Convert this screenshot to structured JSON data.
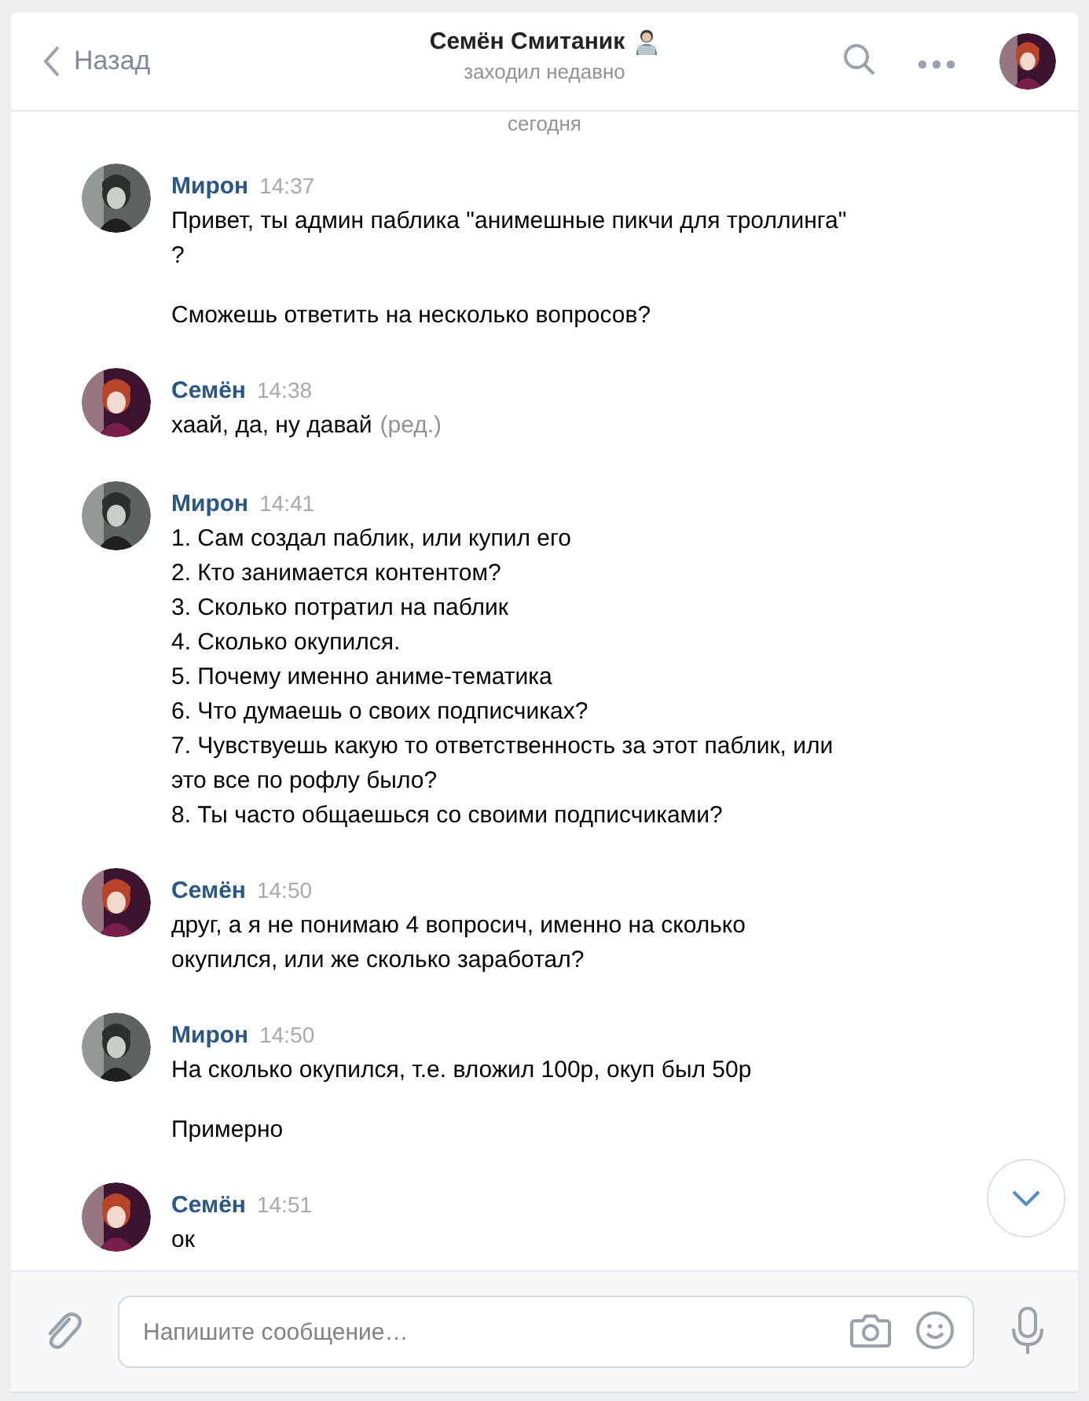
{
  "header": {
    "back_label": "Назад",
    "title": "Семён Смитаник",
    "status": "заходил недавно"
  },
  "date_divider": "сегодня",
  "messages": [
    {
      "author": "Мирон",
      "time": "14:37",
      "paragraphs": [
        [
          "Привет, ты админ паблика \"анимешные пикчи для троллинга\"",
          "?"
        ],
        [
          "Сможешь ответить на несколько вопросов?"
        ]
      ]
    },
    {
      "author": "Семён",
      "time": "14:38",
      "paragraphs": [
        [
          "хаай, да, ну давай"
        ]
      ],
      "edited_label": "(ред.)"
    },
    {
      "author": "Мирон",
      "time": "14:41",
      "paragraphs": [
        [
          "1. Сам создал паблик, или купил его",
          "2. Кто занимается контентом?",
          "3. Сколько потратил на паблик",
          "4. Сколько окупился.",
          "5. Почему именно аниме-тематика",
          "6. Что думаешь о своих подписчиках?",
          "7. Чувствуешь какую то ответственность за этот паблик, или",
          "это все по рофлу было?",
          "8. Ты часто общаешься со своими подписчиками?"
        ]
      ]
    },
    {
      "author": "Семён",
      "time": "14:50",
      "paragraphs": [
        [
          "друг, а я не понимаю 4 вопросич, именно на сколько",
          "окупился, или же сколько заработал?"
        ]
      ]
    },
    {
      "author": "Мирон",
      "time": "14:50",
      "paragraphs": [
        [
          "На сколько окупился, т.е. вложил 100р, окуп был 50р"
        ],
        [
          "Примерно"
        ]
      ]
    },
    {
      "author": "Семён",
      "time": "14:51",
      "paragraphs": [
        [
          "ок"
        ]
      ]
    }
  ],
  "composer": {
    "placeholder": "Напишите сообщение…"
  }
}
